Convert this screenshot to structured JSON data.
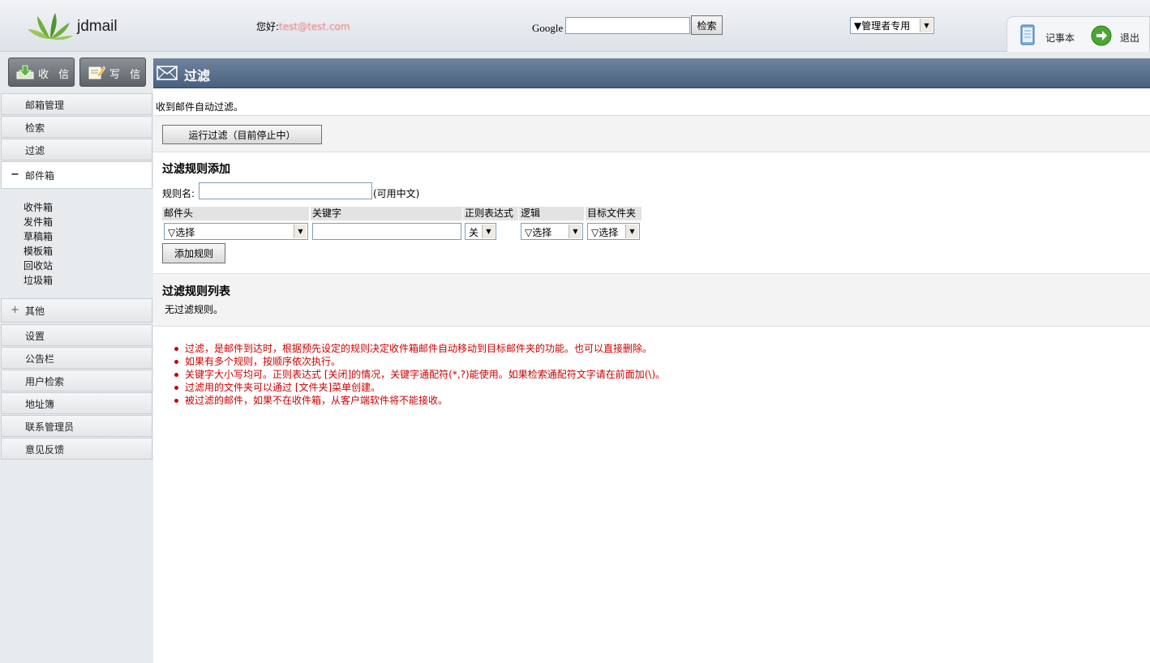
{
  "header": {
    "logo_text": "jdmail",
    "greeting": "您好:",
    "user_email": "test@test.com",
    "search_label": "Google",
    "search_value": "",
    "search_button": "检索",
    "admin_select": "▼管理者专用",
    "memo_label": "记事本",
    "logout_label": "退出"
  },
  "sidebar": {
    "receive_button": "收 信",
    "compose_button": "写 信",
    "items": [
      {
        "label": "邮箱管理"
      },
      {
        "label": "检索"
      },
      {
        "label": "过滤"
      }
    ],
    "mailbox": {
      "sign": "−",
      "label": "邮件箱",
      "folders": [
        "收件箱",
        "发件箱",
        "草稿箱",
        "模板箱",
        "回收站",
        "垃圾箱"
      ]
    },
    "other": {
      "sign": "+",
      "label": "其他",
      "items": [
        {
          "label": "设置"
        },
        {
          "label": "公告栏"
        },
        {
          "label": "用户检索"
        },
        {
          "label": "地址簿"
        },
        {
          "label": "联系管理员"
        },
        {
          "label": "意见反馈"
        }
      ]
    }
  },
  "main": {
    "title": "过滤",
    "intro": "收到邮件自动过滤。",
    "run_button": "运行过滤（目前停止中）",
    "add_section_title": "过滤规则添加",
    "rule_name_label": "规则名:",
    "rule_name_value": "",
    "rule_name_note": "(可用中文)",
    "columns": [
      "邮件头",
      "关键字",
      "正则表达式",
      "逻辑",
      "目标文件夹"
    ],
    "header_select": "▽选择",
    "keyword_value": "",
    "regex_select": "关",
    "logic_select": "▽选择",
    "folder_select": "▽选择",
    "add_button": "添加规则",
    "list_section_title": "过滤规则列表",
    "no_rules": "无过滤规则。",
    "notes": [
      "过滤，是邮件到达时，根据预先设定的规则决定收件箱邮件自动移动到目标邮件夹的功能。也可以直接删除。",
      "如果有多个规则，按顺序依次执行。",
      "关键字大小写均可。正则表达式 [关闭]的情况，关键字通配符(*,?)能使用。如果检索通配符文字请在前面加(\\)。",
      "过滤用的文件夹可以通过 [文件夹]菜单创建。",
      "被过滤的邮件，如果不在收件箱，从客户端软件将不能接收。"
    ]
  }
}
